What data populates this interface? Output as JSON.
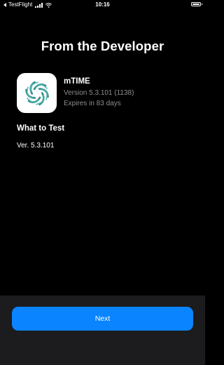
{
  "status_bar": {
    "back_app": "TestFlight",
    "time": "10:16"
  },
  "page": {
    "title": "From the Developer"
  },
  "app": {
    "name": "mTIME",
    "version": "Version 5.3.101 (1138)",
    "expires": "Expires in 83 days",
    "icon": "mtime-logo-icon",
    "icon_color": "#2b8c8a"
  },
  "what_to_test": {
    "heading": "What to Test",
    "notes": "Ver. 5.3.101"
  },
  "footer": {
    "next_label": "Next"
  },
  "colors": {
    "background": "#000000",
    "panel": "#1c1c1e",
    "accent": "#0a84ff",
    "secondary_text": "#8e8e93"
  }
}
